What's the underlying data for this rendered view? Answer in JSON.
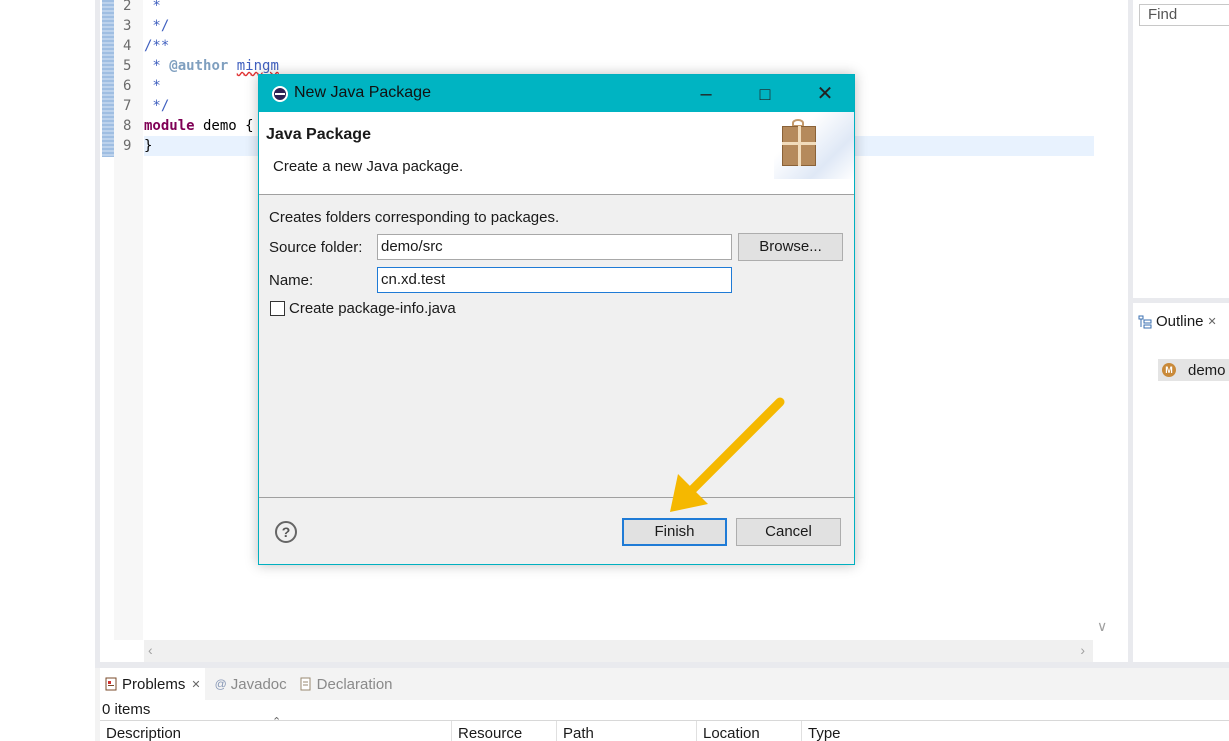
{
  "editor": {
    "lines": [
      {
        "num": "2",
        "text": " *"
      },
      {
        "num": "3",
        "text": " */"
      },
      {
        "num": "4",
        "text": "/**"
      },
      {
        "num": "5",
        "prefix": " * ",
        "tag": "@author",
        "author": "mingm"
      },
      {
        "num": "6",
        "text": " *"
      },
      {
        "num": "7",
        "text": " */"
      },
      {
        "num": "8",
        "keyword": "module",
        "rest": " demo {"
      },
      {
        "num": "9",
        "text": "}"
      }
    ]
  },
  "right_panel": {
    "find_placeholder": "Find",
    "outline_tab": "Outline",
    "outline_item": "demo"
  },
  "bottom_panel": {
    "tabs": [
      {
        "label": "Problems",
        "icon": "problems-icon"
      },
      {
        "label": "Javadoc",
        "icon": "at-icon"
      },
      {
        "label": "Declaration",
        "icon": "declaration-icon"
      }
    ],
    "items_count": "0 items",
    "columns": [
      "Description",
      "Resource",
      "Path",
      "Location",
      "Type"
    ]
  },
  "dialog": {
    "window_title": "New Java Package",
    "header_title": "Java Package",
    "header_desc": "Create a new Java package.",
    "info_text": "Creates folders corresponding to packages.",
    "source_folder_label": "Source folder:",
    "source_folder_value": "demo/src",
    "browse_label": "Browse...",
    "name_label": "Name:",
    "name_value": "cn.xd.test",
    "checkbox_label": "Create package-info.java",
    "checkbox_checked": false,
    "finish_label": "Finish",
    "cancel_label": "Cancel"
  },
  "colors": {
    "titlebar": "#00b4c2",
    "annotation_arrow": "#f5b800",
    "focus_border": "#1f7bd6"
  }
}
